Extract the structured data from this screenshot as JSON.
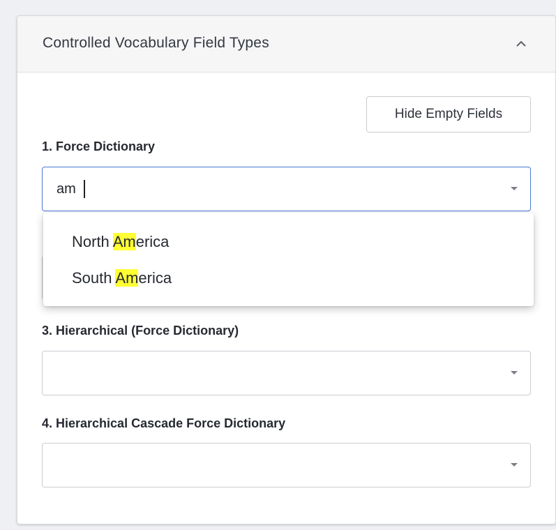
{
  "panel": {
    "title": "Controlled Vocabulary Field Types",
    "collapse_icon": "chevron-up-icon"
  },
  "toolbar": {
    "hide_empty_label": "Hide Empty Fields"
  },
  "fields": [
    {
      "label": "1. Force Dictionary",
      "value": "am",
      "focused": true
    },
    {
      "label": "3. Hierarchical (Force Dictionary)",
      "value": ""
    },
    {
      "label": "4. Hierarchical Cascade Force Dictionary",
      "value": ""
    }
  ],
  "dropdown": {
    "options": [
      {
        "before": "North ",
        "match": "Am",
        "after": "erica"
      },
      {
        "before": "South ",
        "match": "Am",
        "after": "erica"
      }
    ],
    "highlight_color": "#ffff33"
  },
  "colors": {
    "focus_border": "#4a78d6",
    "header_bg": "#f6f6f7"
  }
}
